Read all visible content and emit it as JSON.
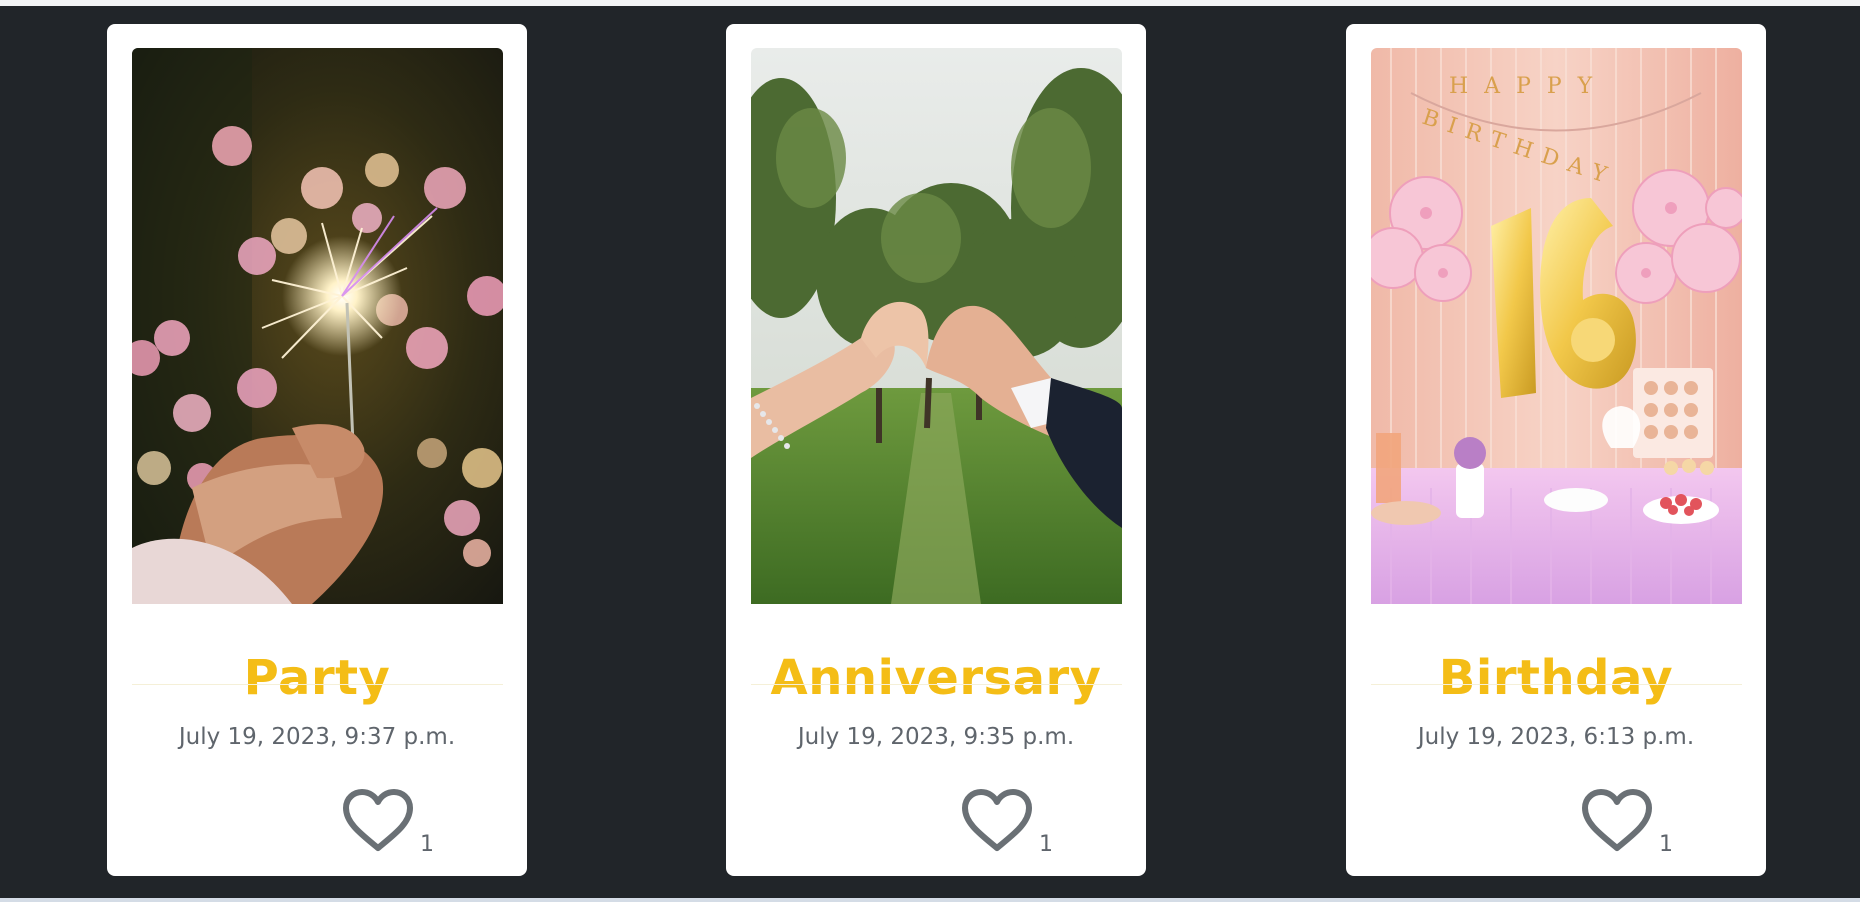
{
  "cards": [
    {
      "title": "Party",
      "date": "July 19, 2023, 9:37 p.m.",
      "likes": "1",
      "photo": "sparkler-in-hand-with-bokeh-lights"
    },
    {
      "title": "Anniversary",
      "date": "July 19, 2023, 9:35 p.m.",
      "likes": "1",
      "photo": "hands-forming-heart-over-orchard-path"
    },
    {
      "title": "Birthday",
      "date": "July 19, 2023, 6:13 p.m.",
      "likes": "1",
      "photo": "pink-birthday-decor-with-gold-16-balloons"
    }
  ],
  "birthday_banner": {
    "line1": "HAPPY",
    "line2": "BIRTHDAY"
  },
  "colors": {
    "page_background": "#212529",
    "card_background": "#ffffff",
    "title_color": "#f4bd16",
    "muted_text": "#5f656c"
  },
  "icons": {
    "like": "heart-outline-icon"
  }
}
